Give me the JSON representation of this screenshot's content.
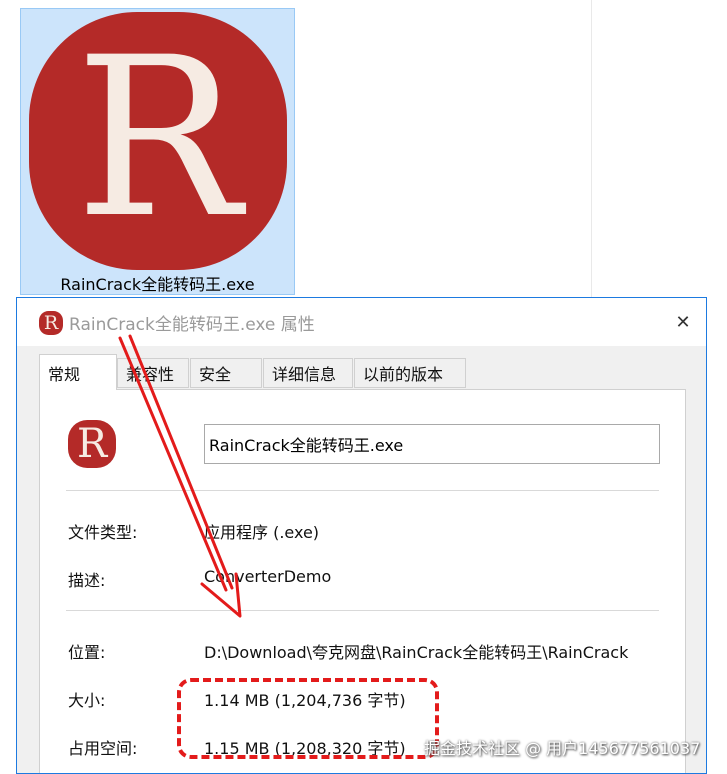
{
  "file_tile": {
    "logo_letter": "R",
    "file_name": "RainCrack全能转码王.exe"
  },
  "dialog": {
    "title": "RainCrack全能转码王.exe 属性",
    "close_glyph": "✕",
    "tabs": [
      "常规",
      "兼容性",
      "安全",
      "详细信息",
      "以前的版本"
    ],
    "active_tab": "常规",
    "file_name_value": "RainCrack全能转码王.exe",
    "properties": [
      {
        "label": "文件类型:",
        "value": "应用程序 (.exe)"
      },
      {
        "label": "描述:",
        "value": "ConverterDemo"
      },
      {
        "label": "位置:",
        "value": "D:\\Download\\夸克网盘\\RainCrack全能转码王\\RainCrack"
      },
      {
        "label": "大小:",
        "value": "1.14 MB (1,204,736 字节)"
      },
      {
        "label": "占用空间:",
        "value": "1.15 MB (1,208,320 字节)"
      }
    ]
  },
  "annotation": {
    "color": "#e31b1b"
  },
  "watermark": "掘金技术社区 @ 用户145677561037",
  "colors": {
    "logo_red": "#b42a28",
    "selection_blue": "#cce4fb",
    "dialog_border": "#1d7ae0"
  }
}
